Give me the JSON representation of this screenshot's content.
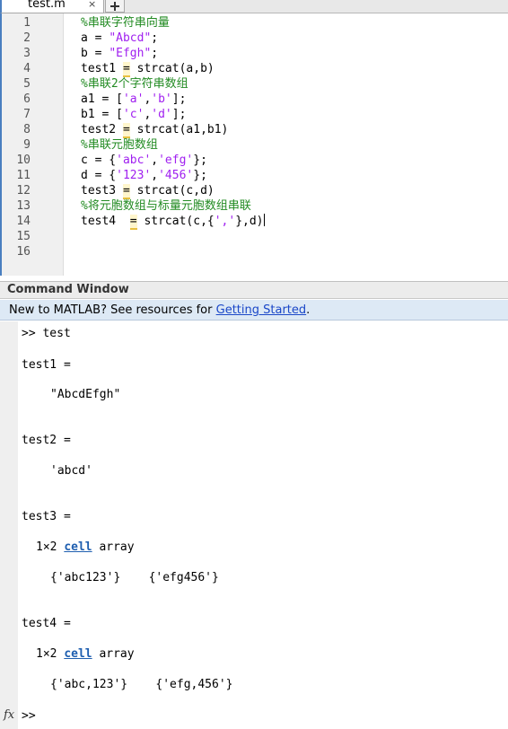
{
  "tab": {
    "filename": "test.m",
    "close": "×"
  },
  "editor": {
    "line_numbers": [
      "1",
      "2",
      "3",
      "4",
      "5",
      "6",
      "7",
      "8",
      "9",
      "10",
      "11",
      "12",
      "13",
      "14",
      "15",
      "16"
    ],
    "comments": {
      "c1": "%串联字符串向量",
      "c2": "%串联2个字符串数组",
      "c3": "%串联元胞数组",
      "c4": "%将元胞数组与标量元胞数组串联"
    },
    "code": {
      "a_lhs": "a = ",
      "a_str": "\"Abcd\"",
      "semi": ";",
      "b_lhs": "b = ",
      "b_str": "\"Efgh\"",
      "t1_lhs": "test1 ",
      "eq": "=",
      "t1_rhs": " strcat(a,b)",
      "a1_lhs": "a1 = [",
      "a1_s1": "'a'",
      "comma": ",",
      "a1_s2": "'b'",
      "rb_semi": "];",
      "b1_lhs": "b1 = [",
      "b1_s1": "'c'",
      "b1_s2": "'d'",
      "t2_lhs": "test2 ",
      "t2_rhs": " strcat(a1,b1)",
      "c_lhs": "c = {",
      "c_s1": "'abc'",
      "c_s2": "'efg'",
      "rc_semi": "};",
      "d_lhs": "d = {",
      "d_s1": "'123'",
      "d_s2": "'456'",
      "t3_lhs": "test3 ",
      "t3_rhs": " strcat(c,d)",
      "t4_lhs": "test4  ",
      "t4_mid": " strcat(c,{",
      "t4_s": "','",
      "t4_end": "},d)"
    }
  },
  "command_window": {
    "title": "Command Window",
    "banner_text": "New to MATLAB? See resources for ",
    "banner_link": "Getting Started",
    "banner_dot": ".",
    "cmd": ">> test",
    "t1_name": "test1 =",
    "t1_val": "\"AbcdEfgh\"",
    "t2_name": "test2 =",
    "t2_val": "'abcd'",
    "t3_name": "test3 =",
    "size_prefix": "1×2 ",
    "cell_link": "cell",
    "array_word": " array",
    "t3_val": "{'abc123'}    {'efg456'}",
    "t4_name": "test4 =",
    "t4_val": "{'abc,123'}    {'efg,456'}",
    "prompt": ">>",
    "fx": "fx"
  }
}
